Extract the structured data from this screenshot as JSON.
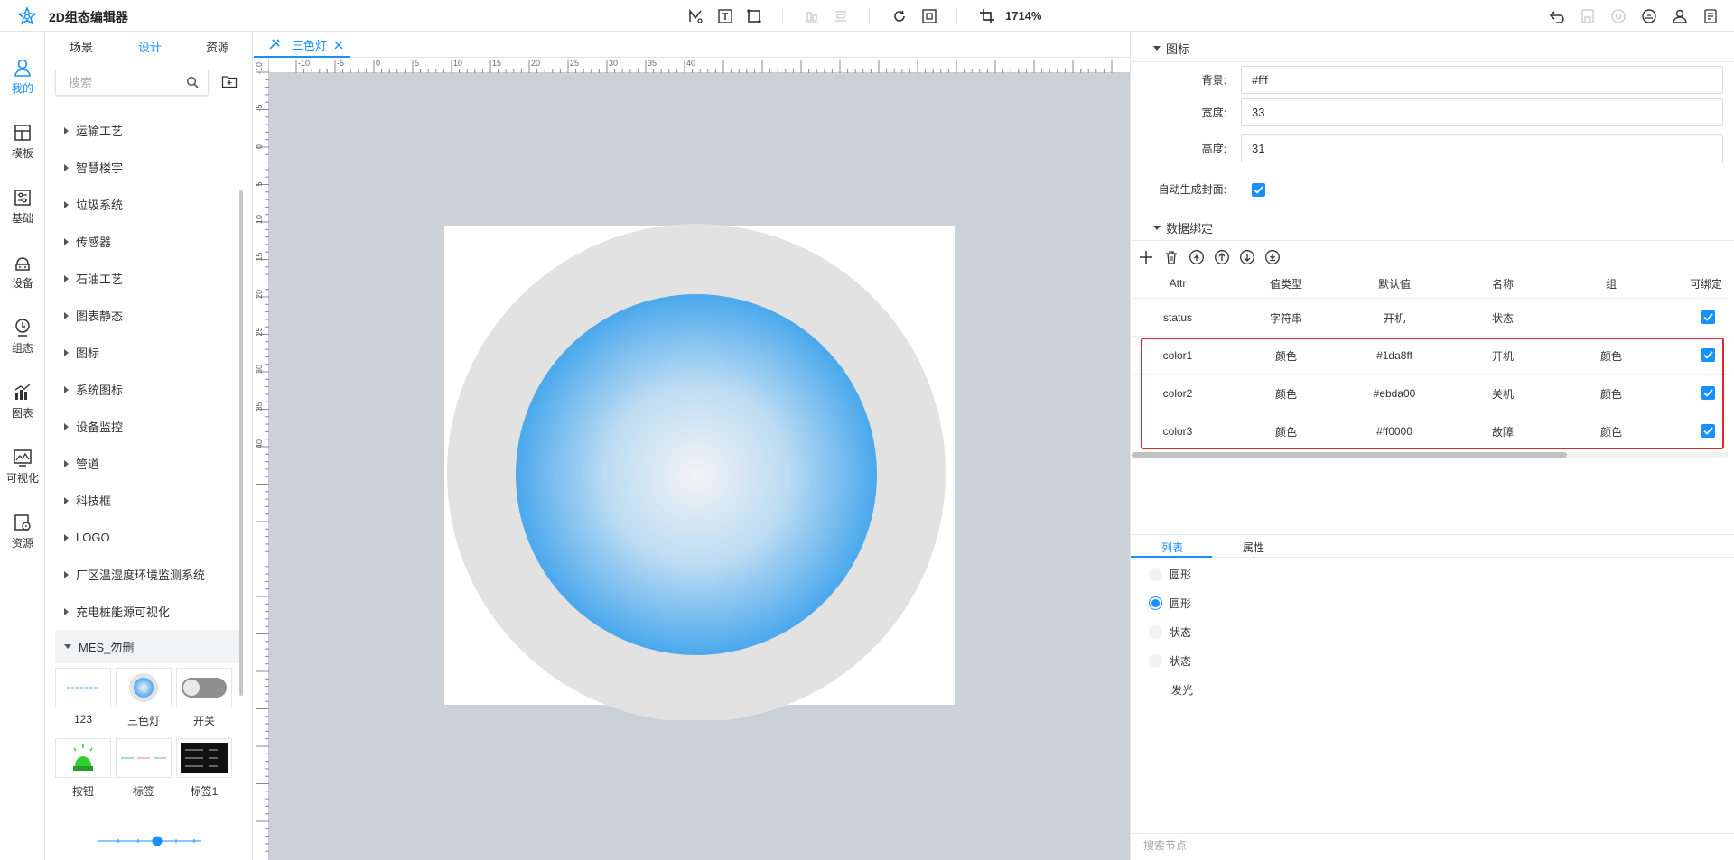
{
  "app": {
    "title": "2D组态编辑器",
    "zoom": "1714%"
  },
  "rail": [
    {
      "label": "我的",
      "icon": "user-icon",
      "active": true
    },
    {
      "label": "模板",
      "icon": "template-icon"
    },
    {
      "label": "基础",
      "icon": "sliders-icon"
    },
    {
      "label": "设备",
      "icon": "device-icon"
    },
    {
      "label": "组态",
      "icon": "composition-icon"
    },
    {
      "label": "图表",
      "icon": "chart-icon"
    },
    {
      "label": "可视化",
      "icon": "visualization-icon"
    },
    {
      "label": "资源",
      "icon": "resource-icon"
    }
  ],
  "left_panel": {
    "tabs": [
      "场景",
      "设计",
      "资源"
    ],
    "active_tab": "设计",
    "search_placeholder": "搜索",
    "tree": [
      "运输工艺",
      "智慧楼宇",
      "垃圾系统",
      "传感器",
      "石油工艺",
      "图表静态",
      "图标",
      "系统图标",
      "设备监控",
      "管道",
      "科技框",
      "LOGO",
      "厂区温湿度环境监测系统",
      "充电桩能源可视化"
    ],
    "open_folder": "MES_勿删",
    "components": [
      "123",
      "三色灯",
      "开关",
      "按钮",
      "标签",
      "标签1"
    ]
  },
  "doc_tab": {
    "label": "三色灯"
  },
  "ruler_h": [
    "-10",
    "-5",
    "0",
    "5",
    "10",
    "15",
    "20",
    "25",
    "30",
    "35",
    "40"
  ],
  "ruler_v": [
    "-10",
    "-5",
    "0",
    "5",
    "10",
    "15",
    "20",
    "25",
    "30",
    "35",
    "40"
  ],
  "right_panel": {
    "section_icon": "图标",
    "props": {
      "bg_label": "背景:",
      "bg_value": "#fff",
      "width_label": "宽度:",
      "width_value": "33",
      "height_label": "高度:",
      "height_value": "31",
      "auto_cover_label": "自动生成封面:"
    },
    "section_binding": "数据绑定",
    "table": {
      "headers": [
        "Attr",
        "值类型",
        "默认值",
        "名称",
        "组",
        "可绑定"
      ],
      "rows": [
        {
          "attr": "status",
          "type": "字符串",
          "default": "开机",
          "name": "状态",
          "group": "",
          "bindable": true
        },
        {
          "attr": "color1",
          "type": "颜色",
          "default": "#1da8ff",
          "name": "开机",
          "group": "颜色",
          "bindable": true
        },
        {
          "attr": "color2",
          "type": "颜色",
          "default": "#ebda00",
          "name": "关机",
          "group": "颜色",
          "bindable": true
        },
        {
          "attr": "color3",
          "type": "颜色",
          "default": "#ff0000",
          "name": "故障",
          "group": "颜色",
          "bindable": true
        }
      ]
    },
    "bottom_tabs": [
      "列表",
      "属性"
    ],
    "layers": [
      {
        "name": "圆形",
        "selected": false
      },
      {
        "name": "圆形",
        "selected": true
      },
      {
        "name": "状态",
        "selected": false
      },
      {
        "name": "状态",
        "selected": false
      },
      {
        "name": "发光",
        "selected": false
      }
    ],
    "node_search_placeholder": "搜索节点"
  },
  "colors": {
    "accent": "#1890ff",
    "highlight": "#e5262a",
    "canvas": "#cbd1d8",
    "lamp": "#4aa8ec"
  }
}
